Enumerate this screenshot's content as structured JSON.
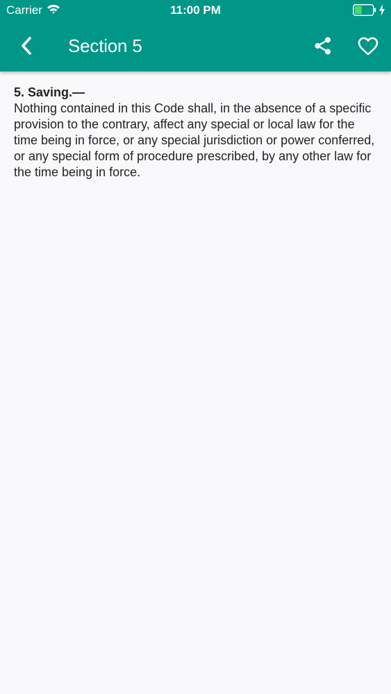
{
  "status_bar": {
    "carrier": "Carrier",
    "time": "11:00 PM",
    "icons": [
      "wifi-icon",
      "battery-icon",
      "bolt-icon"
    ],
    "battery_color": "#4cd964"
  },
  "header": {
    "background_color": "#009688",
    "back_icon": "chevron-left-icon",
    "title": "Section 5",
    "share_icon": "share-icon",
    "favorite_icon": "heart-outline-icon"
  },
  "content": {
    "heading": "5. Saving.—",
    "body": "Nothing contained in this Code shall, in the absence of a specific provision to the contrary, affect any special or local law for the time being in force, or any special jurisdiction or power conferred, or any special form of procedure prescribed, by any other law for the time being in force."
  }
}
